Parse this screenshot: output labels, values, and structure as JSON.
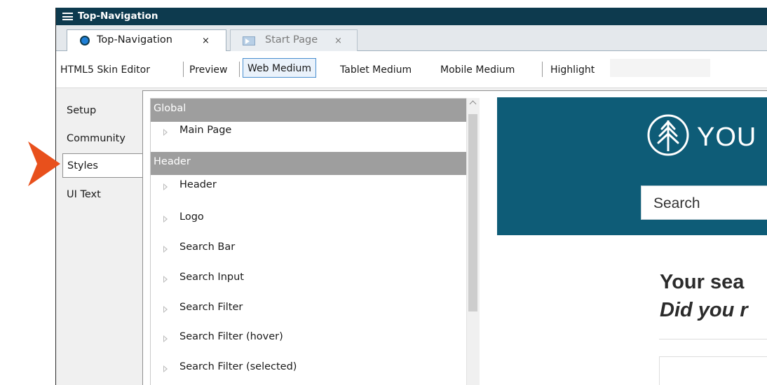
{
  "window": {
    "title": "Top-Navigation"
  },
  "tabs": [
    {
      "label": "Top-Navigation",
      "close": "×",
      "icon": "madcap-project-icon",
      "active": true
    },
    {
      "label": "Start Page",
      "close": "×",
      "icon": "start-page-icon",
      "active": false
    }
  ],
  "toolbar": {
    "skin_editor": "HTML5 Skin Editor",
    "preview": "Preview",
    "web_medium": "Web Medium",
    "tablet_medium": "Tablet Medium",
    "mobile_medium": "Mobile Medium",
    "highlight": "Highlight",
    "selected": "Web Medium"
  },
  "side_tabs": [
    {
      "label": "Setup"
    },
    {
      "label": "Community"
    },
    {
      "label": "Styles",
      "selected": true
    },
    {
      "label": "UI Text"
    }
  ],
  "styles_tree": {
    "groups": [
      {
        "name": "Global",
        "items": [
          "Main Page"
        ]
      },
      {
        "name": "Header",
        "items": [
          "Header",
          "Logo",
          "Search Bar",
          "Search Input",
          "Search Filter",
          "Search Filter (hover)",
          "Search Filter (selected)"
        ]
      }
    ]
  },
  "preview": {
    "brand": "YOU",
    "search_placeholder": "Search",
    "results_line1": "Your sea",
    "results_line2": "Did you r",
    "header_color": "#0e5c77"
  },
  "callout": {
    "icon": "pointer-arrow-icon",
    "color": "#e8501c"
  }
}
